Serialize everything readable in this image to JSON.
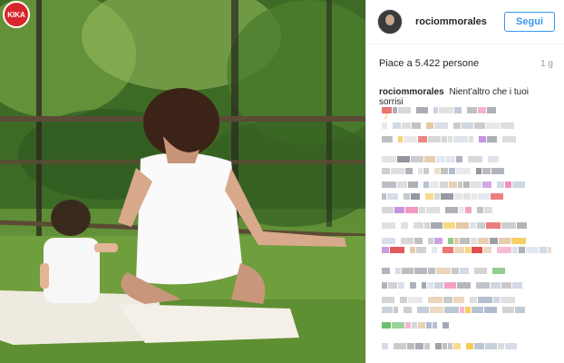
{
  "photo": {
    "watermark_text": "KIKA",
    "description_icon": "photo"
  },
  "post": {
    "username": "rociommorales",
    "follow_label": "Segui",
    "likes": "Piace a 5.422 persone",
    "time": "1 g",
    "caption_user": "rociommorales",
    "caption_text": "Nient'altro che i tuoi sorrisi",
    "caption_emoji": "☽"
  },
  "colors": {
    "accent": "#3897f0",
    "watermark": "#d8252d"
  }
}
